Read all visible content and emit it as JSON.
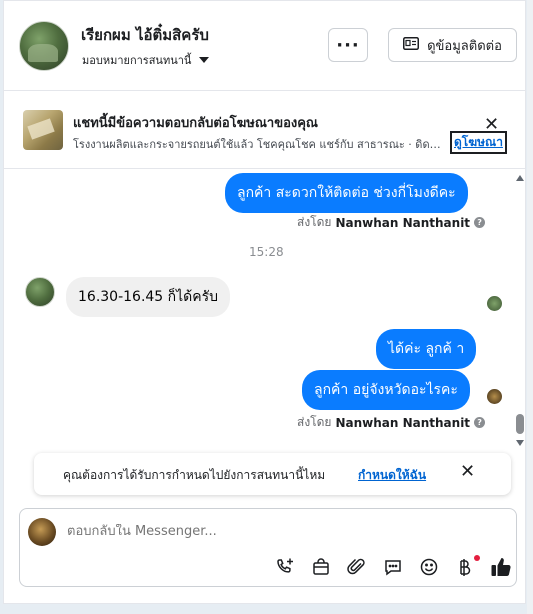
{
  "header": {
    "page_name": "เรียกผม ไอ้ติ๋มสิครับ",
    "assign_label": "มอบหมายการสนทนานี้",
    "more_label": "···",
    "contact_label": "ดูข้อมูลติดต่อ"
  },
  "ad_banner": {
    "title": "แชทนี้มีข้อความตอบกลับต่อโฆษณาของคุณ",
    "subtitle": "โรงงานผลิตและกระจายรถยนต์ใช้แล้ว โชคคุณโชค แชร์กับ สาธารณะ · ดิดตามและส่งข้อความถึงเรา",
    "link_label": "ดูโฆษณา",
    "close_label": "✕"
  },
  "messages": {
    "m1": "ลูกค้า สะดวกให้ติดต่อ ช่วงกี่โมงดีคะ",
    "sent_by_prefix": "ส่งโดย",
    "sender": "Nanwhan Nanthanit",
    "time": "15:28",
    "m2": "16.30-16.45 ก็ได้ครับ",
    "m3": "ได้ค่ะ  ลูกค้ า",
    "m4": "ลูกค้า  อยู่จังหวัดอะไรคะ"
  },
  "notification": {
    "text": "คุณต้องการได้รับการกำหนดไปยังการสนทนานี้ไหม",
    "link": "กำหนดให้ฉัน",
    "close": "✕"
  },
  "composer": {
    "placeholder": "ตอบกลับใน Messenger..."
  },
  "colors": {
    "accent": "#0a7cff",
    "link": "#0064d1"
  },
  "icons": [
    "more-icon",
    "contact-card-icon",
    "close-icon",
    "info-icon",
    "call-add-icon",
    "shopping-bag-icon",
    "paperclip-icon",
    "chat-bubble-icon",
    "emoji-icon",
    "baht-icon",
    "thumbs-up-icon"
  ]
}
